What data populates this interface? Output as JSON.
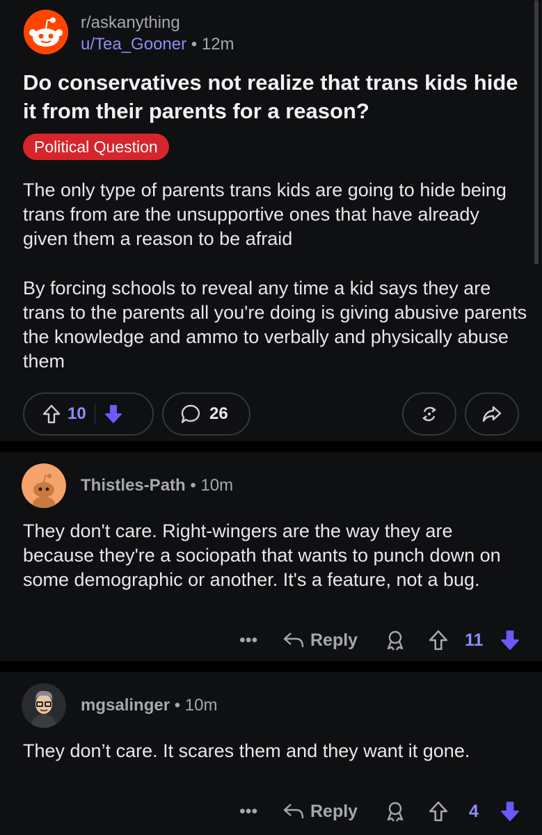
{
  "post": {
    "subreddit": "r/askanything",
    "author": "u/Tea_Gooner",
    "separator": "•",
    "time": "12m",
    "title": "Do conservatives not realize that trans kids hide it from their parents for a reason?",
    "flair": "Political Question",
    "paragraphs": [
      "The only type of parents trans kids are going to hide being trans from are the unsupportive ones that have already given them a reason to be afraid",
      "By forcing schools to reveal any time a kid says they are trans to the parents all you're doing is giving abusive parents the knowledge and ammo to verbally and physically abuse them"
    ],
    "upvotes": "10",
    "comments": "26"
  },
  "comments": [
    {
      "author": "Thistles-Path",
      "separator": "•",
      "time": "10m",
      "text": "They don't care. Right-wingers are the way they are because they're a sociopath that wants to punch down on some demographic or another. It's a feature, not a bug.",
      "more": "•••",
      "reply": "Reply",
      "votes": "11"
    },
    {
      "author": "mgsalinger",
      "separator": "•",
      "time": "10m",
      "text": "They don’t care. It scares them and they want it gone.",
      "more": "•••",
      "reply": "Reply",
      "votes": "4"
    }
  ],
  "colors": {
    "background": "#0f1012",
    "accent_upvote": "#8c8ff7",
    "downvote": "#6a5af9",
    "flair": "#d6252b",
    "snoo": "#ff4500"
  },
  "icons": [
    "upvote-icon",
    "downvote-icon",
    "comment-bubble-icon",
    "award-icon",
    "share-icon",
    "more-icon",
    "reply-arrow-icon",
    "award-outline-icon"
  ]
}
